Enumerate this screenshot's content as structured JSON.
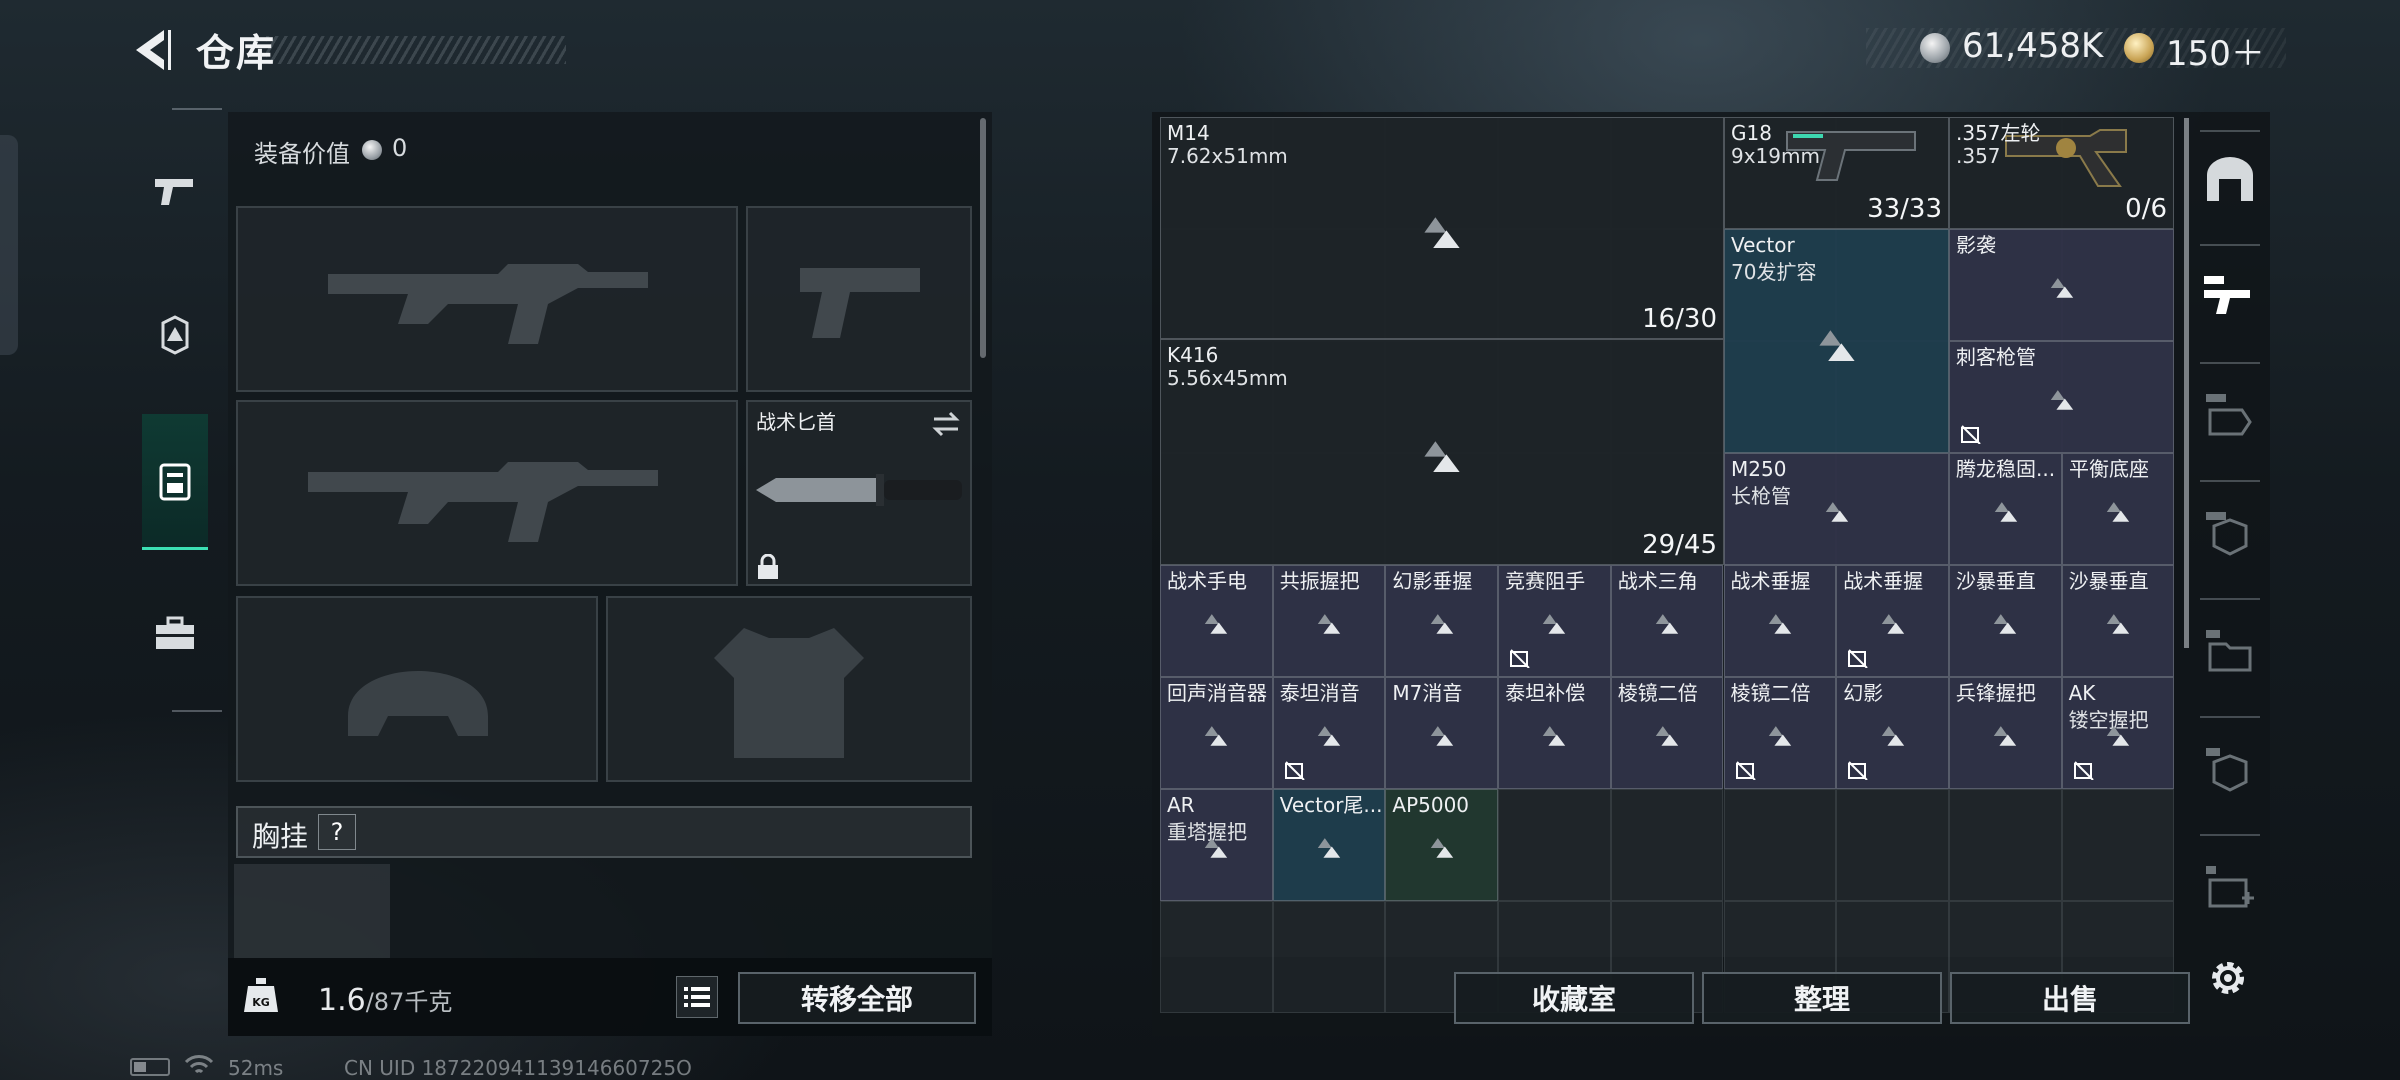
{
  "header": {
    "title": "仓库",
    "silver": "61,458K",
    "gold": "150＋"
  },
  "loadout": {
    "equip_value_label": "装备价值",
    "equip_value": "0",
    "melee_name": "战术匕首",
    "chest_rig_label": "胸挂",
    "help_label": "?",
    "weight_current": "1.6",
    "weight_max": "/87千克",
    "weight_icon_label": "KG",
    "transfer_all": "转移全部"
  },
  "status": {
    "ping": "52ms",
    "uid": "CN UID 18722094113914660725O"
  },
  "inventory": {
    "items": [
      {
        "name": "M14",
        "sub": "7.62x51mm",
        "count": "16/30"
      },
      {
        "name": "G18",
        "sub": "9x19mm",
        "count": "33/33"
      },
      {
        "name": ".357左轮",
        "sub": ".357",
        "count": "0/6"
      },
      {
        "name": "Vector",
        "sub": "70发扩容"
      },
      {
        "name": "影袭"
      },
      {
        "name": "K416",
        "sub": "5.56x45mm",
        "count": "29/45"
      },
      {
        "name": "刺客枪管"
      },
      {
        "name": "M250",
        "sub": "长枪管"
      },
      {
        "name": "腾龙稳固..."
      },
      {
        "name": "平衡底座"
      },
      {
        "name": "战术手电"
      },
      {
        "name": "共振握把"
      },
      {
        "name": "幻影垂握"
      },
      {
        "name": "竞赛阻手"
      },
      {
        "name": "战术三角"
      },
      {
        "name": "战术垂握"
      },
      {
        "name": "战术垂握"
      },
      {
        "name": "沙暴垂直"
      },
      {
        "name": "沙暴垂直"
      },
      {
        "name": "回声消音器"
      },
      {
        "name": "泰坦消音"
      },
      {
        "name": "M7消音"
      },
      {
        "name": "泰坦补偿"
      },
      {
        "name": "棱镜二倍"
      },
      {
        "name": "棱镜二倍"
      },
      {
        "name": "幻影"
      },
      {
        "name": "兵锋握把"
      },
      {
        "name": "AK",
        "sub": "镂空握把"
      },
      {
        "name": "AR",
        "sub": "重塔握把"
      },
      {
        "name": "Vector尾..."
      },
      {
        "name": "AP5000"
      }
    ]
  },
  "actions": {
    "collection": "收藏室",
    "sort": "整理",
    "sell": "出售"
  }
}
